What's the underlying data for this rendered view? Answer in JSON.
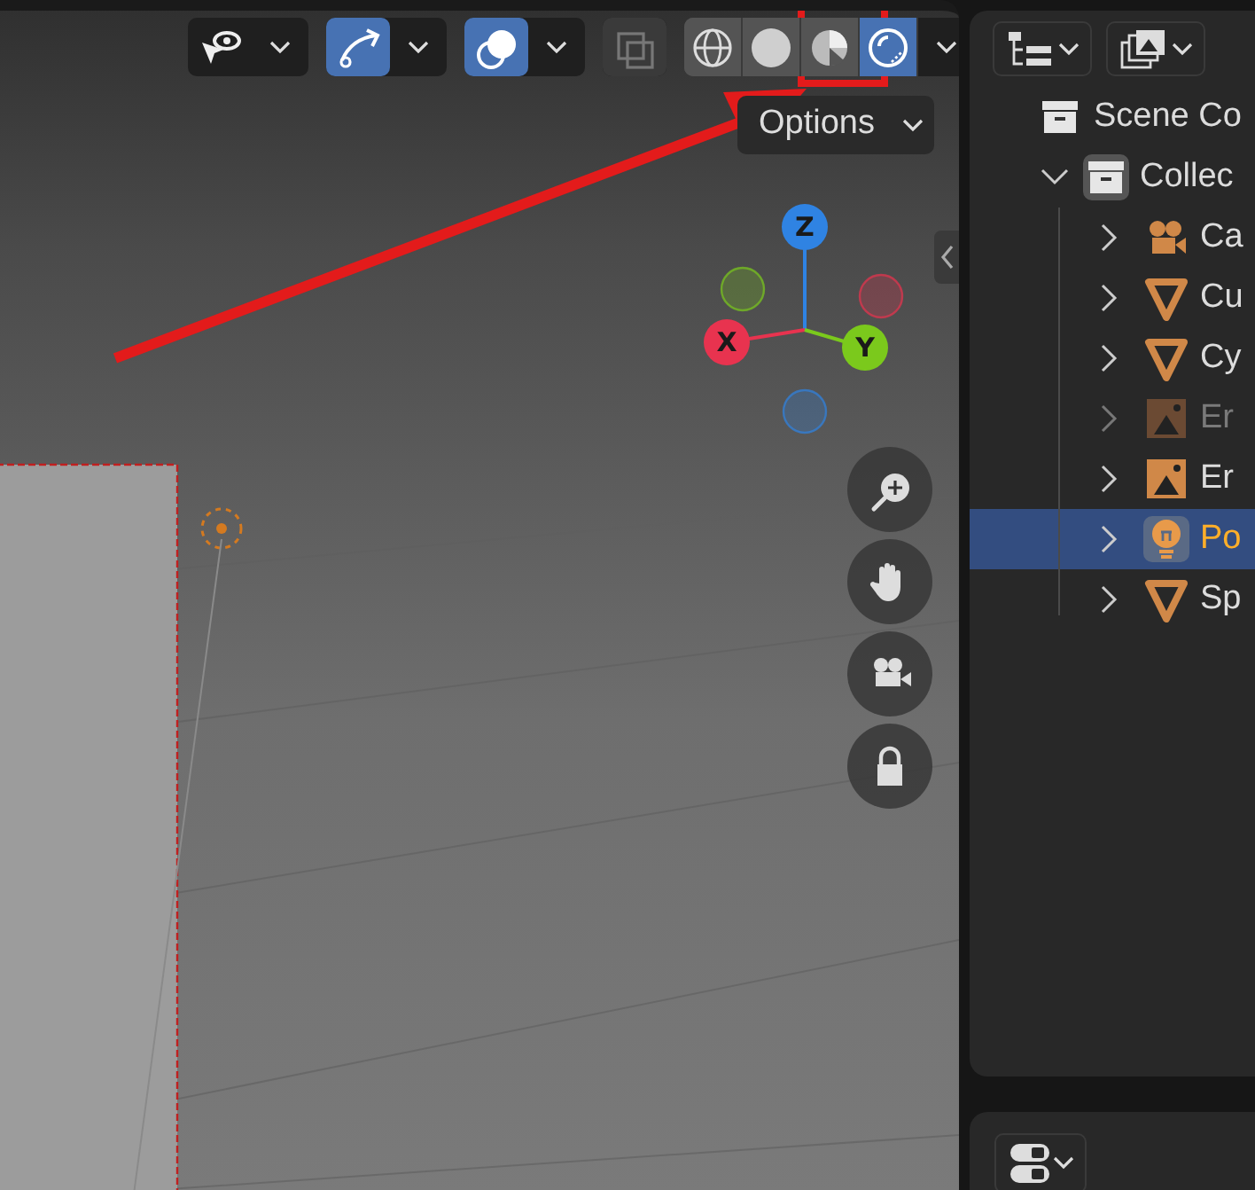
{
  "viewport": {
    "header": [
      {
        "kind": "visibility",
        "on": false
      },
      {
        "kind": "gizmo",
        "on": true
      },
      {
        "kind": "overlay",
        "on": true
      },
      {
        "kind": "xray",
        "on": false
      }
    ],
    "shading": [
      {
        "kind": "wireframe",
        "selected": false
      },
      {
        "kind": "solid",
        "selected": false
      },
      {
        "kind": "material",
        "selected": false
      },
      {
        "kind": "rendered",
        "selected": true
      }
    ],
    "options_label": "Options",
    "gizmo_axes": [
      {
        "label": "Z",
        "color": "#2f83e3"
      },
      {
        "label": "X",
        "color": "#e8334f"
      },
      {
        "label": "Y",
        "color": "#7bc91c"
      }
    ]
  },
  "outliner": {
    "root": {
      "label": "Scene Co",
      "children": [
        {
          "label": "Collec",
          "kind": "collection",
          "expanded": true,
          "selected": false,
          "children": [
            {
              "label": "Ca",
              "kind": "camera",
              "selected": false,
              "disabled": false
            },
            {
              "label": "Cu",
              "kind": "mesh",
              "selected": false,
              "disabled": false
            },
            {
              "label": "Cy",
              "kind": "mesh",
              "selected": false,
              "disabled": false
            },
            {
              "label": "Er",
              "kind": "image",
              "selected": false,
              "disabled": true
            },
            {
              "label": "Er",
              "kind": "image",
              "selected": false,
              "disabled": false
            },
            {
              "label": "Po",
              "kind": "light",
              "selected": true,
              "disabled": false
            },
            {
              "label": "Sp",
              "kind": "mesh",
              "selected": false,
              "disabled": false
            }
          ]
        }
      ]
    }
  }
}
